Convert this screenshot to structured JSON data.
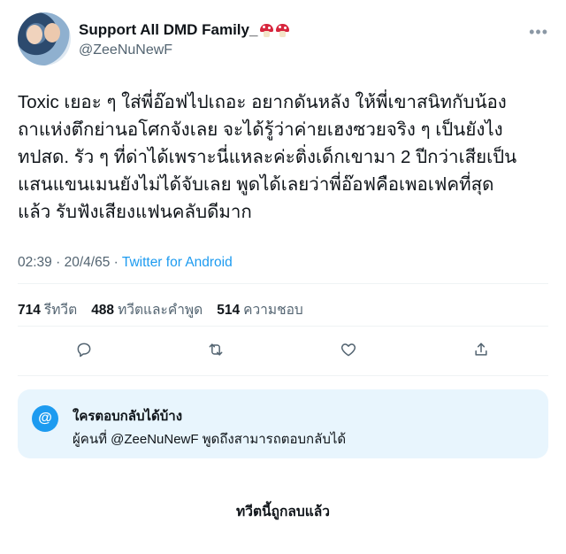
{
  "author": {
    "display_name": "Support All DMD Family_",
    "handle": "@ZeeNuNewF",
    "name_emojis": [
      "mushroom",
      "mushroom"
    ]
  },
  "tweet": {
    "text": "Toxic เยอะ ๆ  ใส่พี่อ๊อฟไปเถอะ อยากดันหลัง ให้พี่เขาสนิทกับน้อง\nถาแห่งตึกย่านอโศกจังเลย จะได้รู้ว่าค่ายเฮงซวยจริง ๆ เป็นยังไง\nทปสด. รัว ๆ ที่ด่าได้เพราะนี่แหละค่ะติ่งเด็กเขามา 2 ปีกว่าเสียเป็น\nแสนแขนเมนยังไม่ได้จับเลย พูดได้เลยว่าพี่อ๊อฟคือเพอเฟคที่สุด\nแล้ว รับฟังเสียงแฟนคลับดีมาก",
    "time": "02:39",
    "date": "20/4/65",
    "separator": "·",
    "source": "Twitter for Android"
  },
  "stats": {
    "retweets_count": "714",
    "retweets_label": "รีทวีต",
    "quotes_count": "488",
    "quotes_label": "ทวีตและคำพูด",
    "likes_count": "514",
    "likes_label": "ความชอบ"
  },
  "actions": {
    "icons": [
      "reply-icon",
      "retweet-icon",
      "like-icon",
      "share-icon"
    ]
  },
  "reply_settings": {
    "icon_symbol": "@",
    "title": "ใครตอบกลับได้บ้าง",
    "description": "ผู้คนที่ @ZeeNuNewF พูดถึงสามารถตอบกลับได้"
  },
  "footer": {
    "deleted_notice": "ทวีตนี้ถูกลบแล้ว"
  },
  "colors": {
    "accent": "#1d9bf0",
    "text": "#0f1419",
    "secondary": "#536471",
    "card_bg": "#e8f5fd"
  }
}
